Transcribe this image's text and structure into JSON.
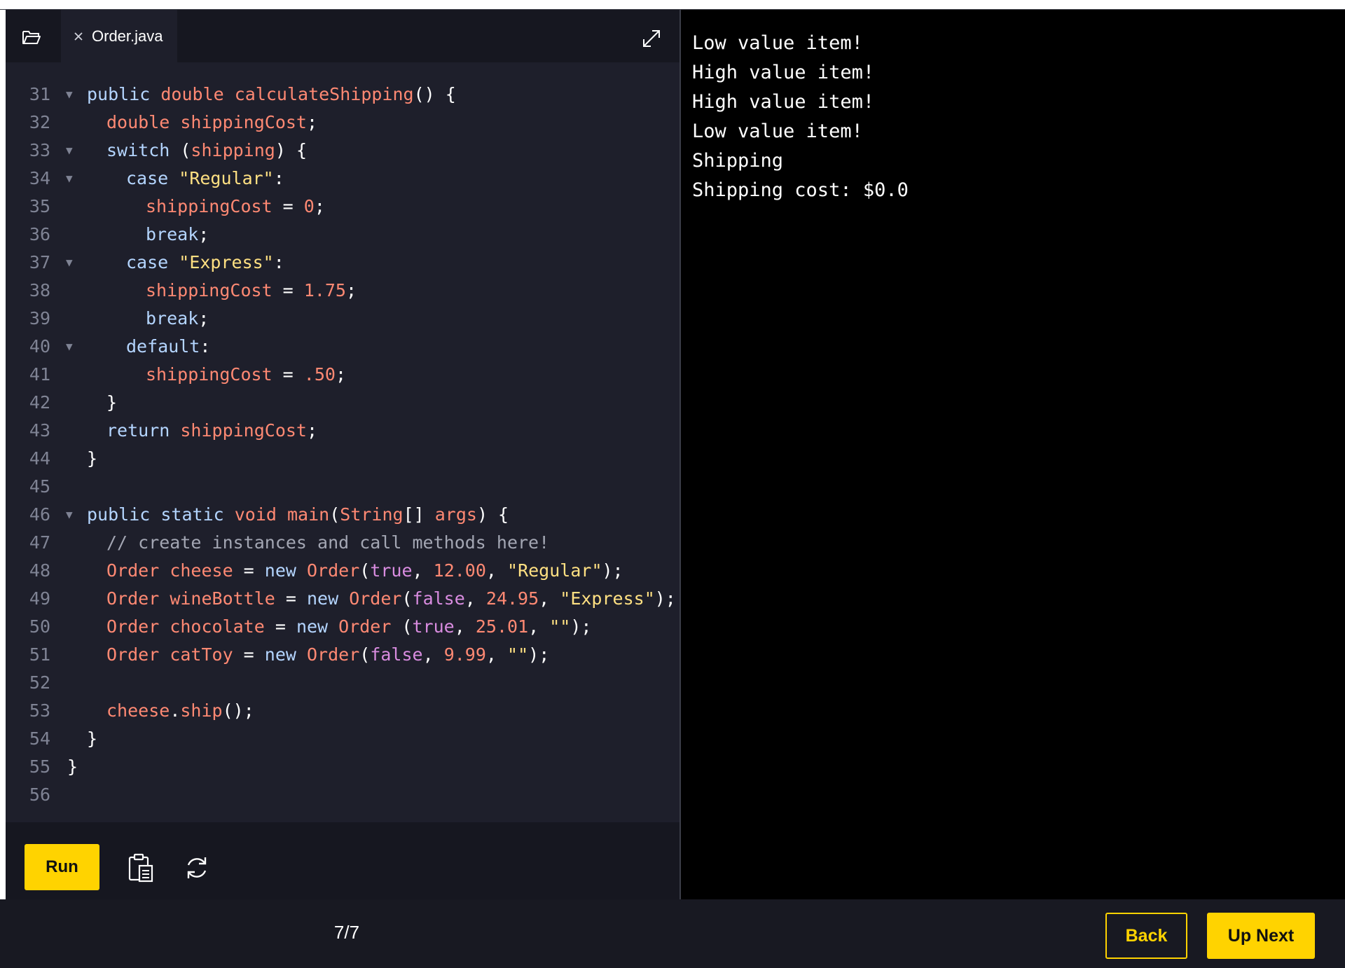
{
  "editor": {
    "tab_label": "Order.java",
    "lines": [
      {
        "num": "31",
        "fold": true,
        "indent": 1,
        "tokens": [
          [
            "kw",
            "public "
          ],
          [
            "id",
            "double "
          ],
          [
            "id",
            "calculateShipping"
          ],
          [
            "pun",
            "() {"
          ]
        ]
      },
      {
        "num": "32",
        "fold": false,
        "indent": 2,
        "tokens": [
          [
            "id",
            "double "
          ],
          [
            "id",
            "shippingCost"
          ],
          [
            "pun",
            ";"
          ]
        ]
      },
      {
        "num": "33",
        "fold": true,
        "indent": 2,
        "tokens": [
          [
            "kw",
            "switch "
          ],
          [
            "pun",
            "("
          ],
          [
            "id",
            "shipping"
          ],
          [
            "pun",
            ") {"
          ]
        ]
      },
      {
        "num": "34",
        "fold": true,
        "indent": 3,
        "tokens": [
          [
            "kw",
            "case "
          ],
          [
            "str",
            "\"Regular\""
          ],
          [
            "pun",
            ":"
          ]
        ]
      },
      {
        "num": "35",
        "fold": false,
        "indent": 4,
        "tokens": [
          [
            "id",
            "shippingCost"
          ],
          [
            "pun",
            " = "
          ],
          [
            "num",
            "0"
          ],
          [
            "pun",
            ";"
          ]
        ]
      },
      {
        "num": "36",
        "fold": false,
        "indent": 4,
        "tokens": [
          [
            "kw",
            "break"
          ],
          [
            "pun",
            ";"
          ]
        ]
      },
      {
        "num": "37",
        "fold": true,
        "indent": 3,
        "tokens": [
          [
            "kw",
            "case "
          ],
          [
            "str",
            "\"Express\""
          ],
          [
            "pun",
            ":"
          ]
        ]
      },
      {
        "num": "38",
        "fold": false,
        "indent": 4,
        "tokens": [
          [
            "id",
            "shippingCost"
          ],
          [
            "pun",
            " = "
          ],
          [
            "num",
            "1.75"
          ],
          [
            "pun",
            ";"
          ]
        ]
      },
      {
        "num": "39",
        "fold": false,
        "indent": 4,
        "tokens": [
          [
            "kw",
            "break"
          ],
          [
            "pun",
            ";"
          ]
        ]
      },
      {
        "num": "40",
        "fold": true,
        "indent": 3,
        "tokens": [
          [
            "kw",
            "default"
          ],
          [
            "pun",
            ":"
          ]
        ]
      },
      {
        "num": "41",
        "fold": false,
        "indent": 4,
        "tokens": [
          [
            "id",
            "shippingCost"
          ],
          [
            "pun",
            " = "
          ],
          [
            "num",
            ".50"
          ],
          [
            "pun",
            ";"
          ]
        ]
      },
      {
        "num": "42",
        "fold": false,
        "indent": 2,
        "tokens": [
          [
            "pun",
            "}"
          ]
        ]
      },
      {
        "num": "43",
        "fold": false,
        "indent": 2,
        "tokens": [
          [
            "kw",
            "return "
          ],
          [
            "id",
            "shippingCost"
          ],
          [
            "pun",
            ";"
          ]
        ]
      },
      {
        "num": "44",
        "fold": false,
        "indent": 1,
        "tokens": [
          [
            "pun",
            "}"
          ]
        ]
      },
      {
        "num": "45",
        "fold": false,
        "indent": 0,
        "tokens": []
      },
      {
        "num": "46",
        "fold": true,
        "indent": 1,
        "tokens": [
          [
            "kw",
            "public static "
          ],
          [
            "id",
            "void "
          ],
          [
            "id",
            "main"
          ],
          [
            "pun",
            "("
          ],
          [
            "id",
            "String"
          ],
          [
            "pun",
            "[] "
          ],
          [
            "id",
            "args"
          ],
          [
            "pun",
            ") {"
          ]
        ]
      },
      {
        "num": "47",
        "fold": false,
        "indent": 2,
        "tokens": [
          [
            "cmt",
            "// create instances and call methods here!"
          ]
        ]
      },
      {
        "num": "48",
        "fold": false,
        "indent": 2,
        "tokens": [
          [
            "id",
            "Order "
          ],
          [
            "id",
            "cheese"
          ],
          [
            "pun",
            " = "
          ],
          [
            "kw",
            "new "
          ],
          [
            "id",
            "Order"
          ],
          [
            "pun",
            "("
          ],
          [
            "bool",
            "true"
          ],
          [
            "pun",
            ", "
          ],
          [
            "num",
            "12.00"
          ],
          [
            "pun",
            ", "
          ],
          [
            "str",
            "\"Regular\""
          ],
          [
            "pun",
            ");"
          ]
        ]
      },
      {
        "num": "49",
        "fold": false,
        "indent": 2,
        "tokens": [
          [
            "id",
            "Order "
          ],
          [
            "id",
            "wineBottle"
          ],
          [
            "pun",
            " = "
          ],
          [
            "kw",
            "new "
          ],
          [
            "id",
            "Order"
          ],
          [
            "pun",
            "("
          ],
          [
            "bool",
            "false"
          ],
          [
            "pun",
            ", "
          ],
          [
            "num",
            "24.95"
          ],
          [
            "pun",
            ", "
          ],
          [
            "str",
            "\"Express\""
          ],
          [
            "pun",
            ");"
          ]
        ]
      },
      {
        "num": "50",
        "fold": false,
        "indent": 2,
        "tokens": [
          [
            "id",
            "Order "
          ],
          [
            "id",
            "chocolate"
          ],
          [
            "pun",
            " = "
          ],
          [
            "kw",
            "new "
          ],
          [
            "id",
            "Order "
          ],
          [
            "pun",
            "("
          ],
          [
            "bool",
            "true"
          ],
          [
            "pun",
            ", "
          ],
          [
            "num",
            "25.01"
          ],
          [
            "pun",
            ", "
          ],
          [
            "str",
            "\"\""
          ],
          [
            "pun",
            ");"
          ]
        ]
      },
      {
        "num": "51",
        "fold": false,
        "indent": 2,
        "tokens": [
          [
            "id",
            "Order "
          ],
          [
            "id",
            "catToy"
          ],
          [
            "pun",
            " = "
          ],
          [
            "kw",
            "new "
          ],
          [
            "id",
            "Order"
          ],
          [
            "pun",
            "("
          ],
          [
            "bool",
            "false"
          ],
          [
            "pun",
            ", "
          ],
          [
            "num",
            "9.99"
          ],
          [
            "pun",
            ", "
          ],
          [
            "str",
            "\"\""
          ],
          [
            "pun",
            ");"
          ]
        ]
      },
      {
        "num": "52",
        "fold": false,
        "indent": 0,
        "tokens": []
      },
      {
        "num": "53",
        "fold": false,
        "indent": 2,
        "tokens": [
          [
            "id",
            "cheese"
          ],
          [
            "pun",
            "."
          ],
          [
            "id",
            "ship"
          ],
          [
            "pun",
            "();"
          ]
        ]
      },
      {
        "num": "54",
        "fold": false,
        "indent": 1,
        "tokens": [
          [
            "pun",
            "}"
          ]
        ]
      },
      {
        "num": "55",
        "fold": false,
        "indent": 0,
        "tokens": [
          [
            "pun",
            "}"
          ]
        ]
      },
      {
        "num": "56",
        "fold": false,
        "indent": 0,
        "tokens": []
      }
    ],
    "run_label": "Run",
    "icons": {
      "folder": "folder-icon",
      "close": "close-icon",
      "expand": "expand-icon",
      "copy": "clipboard-icon",
      "reset": "refresh-icon"
    }
  },
  "output": {
    "lines": [
      "Low value item!",
      "High value item!",
      "High value item!",
      "Low value item!",
      "Shipping",
      "Shipping cost: $0.0"
    ]
  },
  "footer": {
    "progress": "7/7",
    "back_label": "Back",
    "next_label": "Up Next"
  },
  "colors": {
    "accent": "#ffd300",
    "editor_bg": "#1e1f2b",
    "output_bg": "#000000"
  }
}
